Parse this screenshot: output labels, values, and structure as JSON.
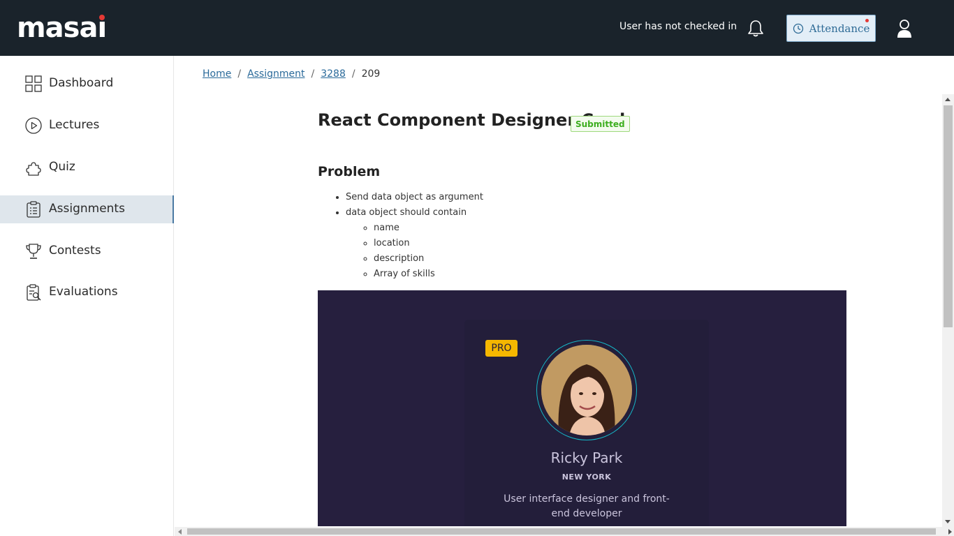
{
  "header": {
    "logo_text_main": "mas",
    "logo_text_end": "ai",
    "checkin_status": "User has not checked in",
    "attendance_label": "Attendance",
    "icons": [
      "bell-icon",
      "clock-icon",
      "user-icon"
    ],
    "accent_color": "#e53935"
  },
  "sidebar": {
    "items": [
      {
        "label": "Dashboard",
        "icon": "dashboard-grid-icon"
      },
      {
        "label": "Lectures",
        "icon": "play-circle-icon"
      },
      {
        "label": "Quiz",
        "icon": "puzzle-icon"
      },
      {
        "label": "Assignments",
        "icon": "clipboard-icon",
        "active": true
      },
      {
        "label": "Contests",
        "icon": "trophy-icon"
      },
      {
        "label": "Evaluations",
        "icon": "evaluation-icon"
      }
    ]
  },
  "breadcrumb": {
    "items": [
      "Home",
      "Assignment",
      "3288"
    ],
    "current": "209",
    "separator": "/"
  },
  "assignment": {
    "title": "React Component Designer Card",
    "status": "Submitted",
    "problem_heading": "Problem",
    "points": [
      "Send data object as argument",
      "data object should contain"
    ],
    "sub_points": [
      "name",
      "location",
      "description",
      "Array of skills"
    ]
  },
  "preview_card": {
    "badge": "PRO",
    "name": "Ricky Park",
    "location": "NEW YORK",
    "description": "User interface designer and front-end developer",
    "background": "#261f3e",
    "ring_color": "#15b7c7",
    "badge_color": "#f5b700"
  }
}
